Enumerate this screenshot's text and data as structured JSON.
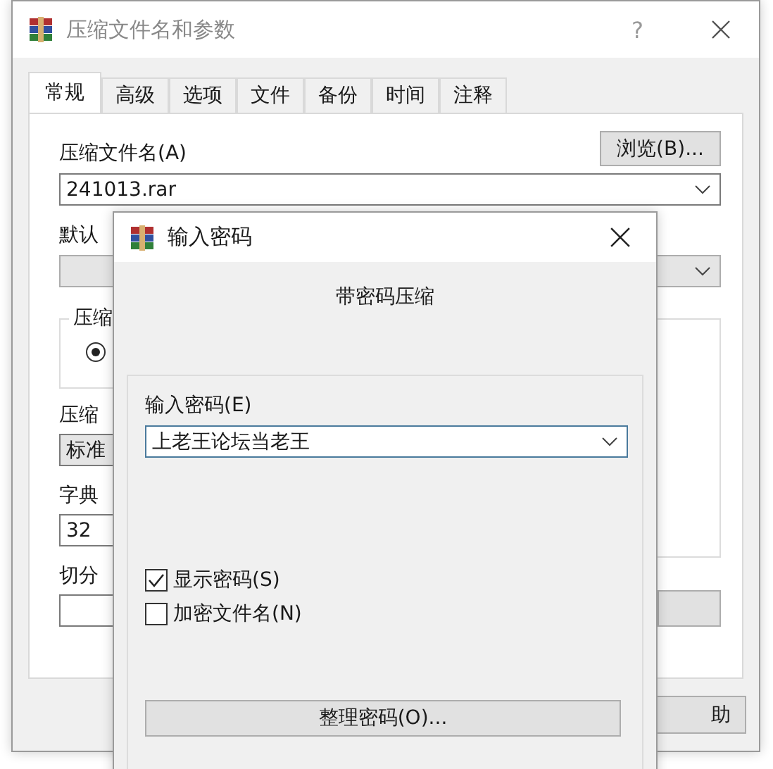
{
  "main_window": {
    "title": "压缩文件名和参数",
    "help_mark": "?",
    "tabs": [
      {
        "label": "常规",
        "selected": true
      },
      {
        "label": "高级",
        "selected": false
      },
      {
        "label": "选项",
        "selected": false
      },
      {
        "label": "文件",
        "selected": false
      },
      {
        "label": "备份",
        "selected": false
      },
      {
        "label": "时间",
        "selected": false
      },
      {
        "label": "注释",
        "selected": false
      }
    ],
    "archive_name_label": "压缩文件名(A)",
    "browse_button": "浏览(B)...",
    "archive_name_value": "241013.rar",
    "profile_label": "默认",
    "format_group_label": "压缩",
    "format_radio": {
      "selected": true
    },
    "method_label": "压缩",
    "method_value": "标准",
    "dictionary_label": "字典",
    "dictionary_value": "32",
    "split_label": "切分",
    "help_button": "助"
  },
  "password_dialog": {
    "title": "输入密码",
    "heading": "带密码压缩",
    "password_label": "输入密码(E)",
    "password_value": "上老王论坛当老王",
    "checkboxes": [
      {
        "label": "显示密码(S)",
        "checked": true
      },
      {
        "label": "加密文件名(N)",
        "checked": false
      }
    ],
    "organize_button": "整理密码(O)..."
  }
}
